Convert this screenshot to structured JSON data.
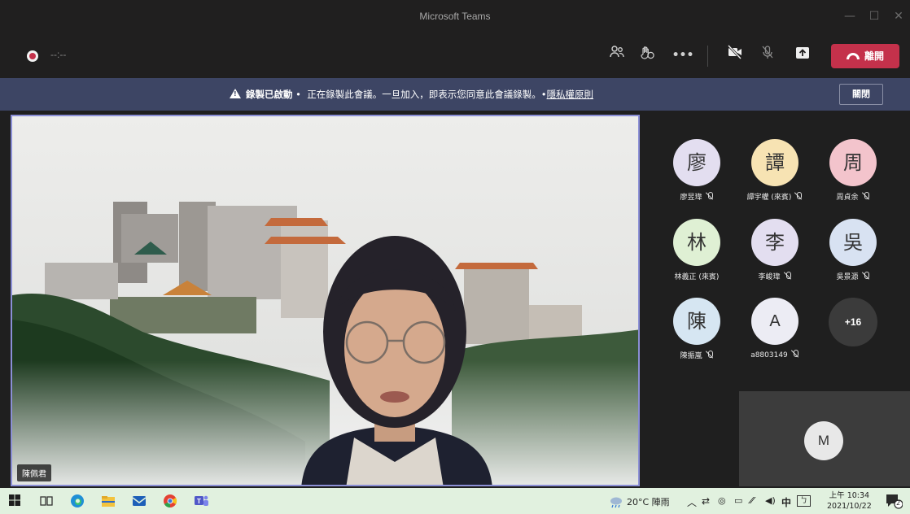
{
  "window": {
    "title": "Microsoft Teams"
  },
  "toolbar": {
    "timer": "--:--",
    "leave_label": "離開",
    "icons": [
      "participants-icon",
      "reactions-icon",
      "more-options-icon",
      "camera-off-icon",
      "mic-off-icon",
      "share-screen-icon"
    ]
  },
  "banner": {
    "title": "錄製已啟動",
    "sep": "•",
    "message": "正在錄製此會議。一旦加入，即表示您同意此會議錄製。",
    "link": "隱私權原則",
    "close_label": "關閉"
  },
  "stage": {
    "speaker_name": "陳佩君"
  },
  "participants": [
    {
      "initial": "廖",
      "name": "廖昱瑋",
      "color": "#e3def0"
    },
    {
      "initial": "譚",
      "name": "譚宇權 (來賓)",
      "color": "#f7e3b3"
    },
    {
      "initial": "周",
      "name": "周貞余",
      "color": "#f3c4cc"
    },
    {
      "initial": "林",
      "name": "林義正 (來賓)",
      "color": "#dff0d4"
    },
    {
      "initial": "李",
      "name": "李峻瑋",
      "color": "#e3def0"
    },
    {
      "initial": "吳",
      "name": "吳景源",
      "color": "#d8e2f2"
    },
    {
      "initial": "陳",
      "name": "陳振嵐",
      "color": "#d6e6f2"
    },
    {
      "initial": "A",
      "name": "a8803149",
      "color": "#ececf4"
    }
  ],
  "more_count": "+16",
  "self_initial": "M",
  "taskbar": {
    "weather": "20°C 陣雨",
    "ime": "中",
    "time": "上午 10:34",
    "date": "2021/10/22",
    "notifications": "2"
  },
  "colors": {
    "accent": "#8b8fd6",
    "leave": "#c4314b",
    "banner": "#3d4564"
  }
}
